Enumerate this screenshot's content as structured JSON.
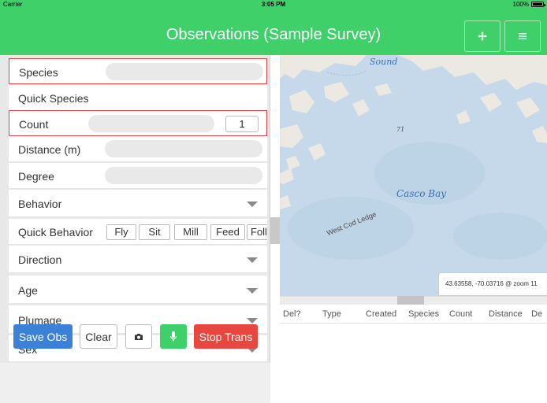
{
  "status_bar": {
    "carrier": "Carrier",
    "time": "3:05 PM",
    "battery": "100%"
  },
  "header": {
    "title": "Observations (Sample Survey)",
    "move_icon": "move-icon",
    "menu_icon": "hamburger-menu-icon"
  },
  "form": {
    "species_label": "Species",
    "species_value": "",
    "quick_species_label": "Quick Species",
    "count_label": "Count",
    "count_value": "1",
    "distance_label": "Distance (m)",
    "degree_label": "Degree",
    "behavior_label": "Behavior",
    "quick_behavior_label": "Quick Behavior",
    "quick_behavior_options": [
      "Fly",
      "Sit",
      "Mill",
      "Feed",
      "Follo"
    ],
    "direction_label": "Direction",
    "age_label": "Age",
    "plumage_label": "Plumage",
    "sex_label": "Sex"
  },
  "actions": {
    "save": "Save Obs",
    "clear": "Clear",
    "camera_icon": "camera-icon",
    "mic_icon": "microphone-icon",
    "stop": "Stop Trans"
  },
  "map": {
    "labels": {
      "sound": "Sound",
      "casco_bay": "Casco Bay",
      "west_cod_ledge": "West Cod Ledge",
      "depth": "71"
    },
    "coordinates": "43.63558, -70.03716 @ zoom 11"
  },
  "table": {
    "columns": [
      "Del?",
      "Type",
      "Created",
      "Species",
      "Count",
      "Distance",
      "De"
    ]
  },
  "colors": {
    "accent_green": "#3fd06a",
    "save_blue": "#3b82d6",
    "stop_red": "#e8473f",
    "highlight_red": "#e0434a"
  }
}
